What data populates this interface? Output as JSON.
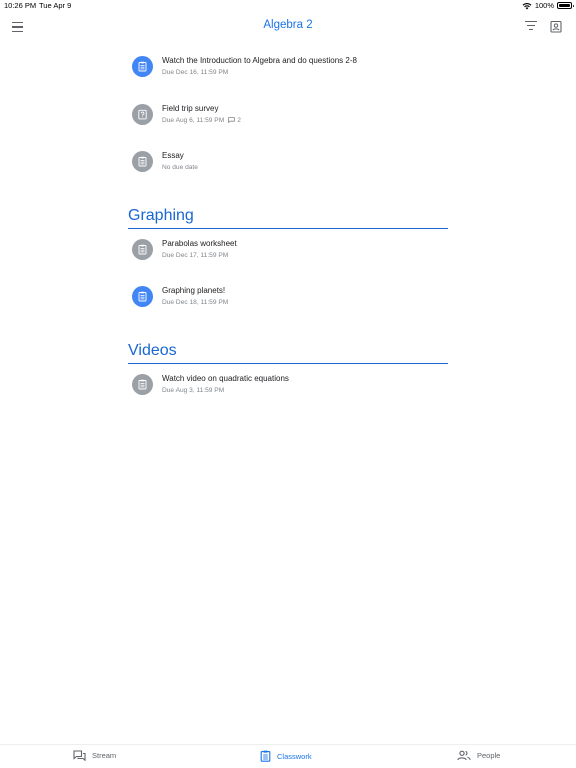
{
  "status_bar": {
    "time": "10:26 PM",
    "date": "Tue Apr 9",
    "battery": "100%"
  },
  "app_bar": {
    "title": "Algebra 2"
  },
  "items_untopiced": [
    {
      "title": "Watch the Introduction to Algebra and do questions 2-8",
      "due": "Due Dec 16, 11:59 PM",
      "icon": "assignment-icon",
      "color": "#4285f4"
    },
    {
      "title": "Field trip survey",
      "due": "Due Aug 6, 11:59 PM",
      "comments": "2",
      "icon": "question-icon",
      "color": "#9aa0a6"
    },
    {
      "title": "Essay",
      "due": "No due date",
      "icon": "assignment-icon",
      "color": "#9aa0a6"
    }
  ],
  "topics": [
    {
      "title": "Graphing",
      "items": [
        {
          "title": "Parabolas worksheet",
          "due": "Due Dec 17, 11:59 PM",
          "icon": "assignment-icon",
          "color": "#9aa0a6"
        },
        {
          "title": "Graphing planets!",
          "due": "Due Dec 18, 11:59 PM",
          "icon": "assignment-icon",
          "color": "#4285f4"
        }
      ]
    },
    {
      "title": "Videos",
      "items": [
        {
          "title": "Watch video on quadratic equations",
          "due": "Due Aug 3, 11:59 PM",
          "icon": "assignment-icon",
          "color": "#9aa0a6"
        }
      ]
    }
  ],
  "bottom_nav": {
    "stream": "Stream",
    "classwork": "Classwork",
    "people": "People",
    "active": "classwork"
  },
  "colors": {
    "accent": "#1a73e8",
    "topic": "#1967d2",
    "inactive_icon": "#9aa0a6",
    "active_icon": "#4285f4"
  }
}
